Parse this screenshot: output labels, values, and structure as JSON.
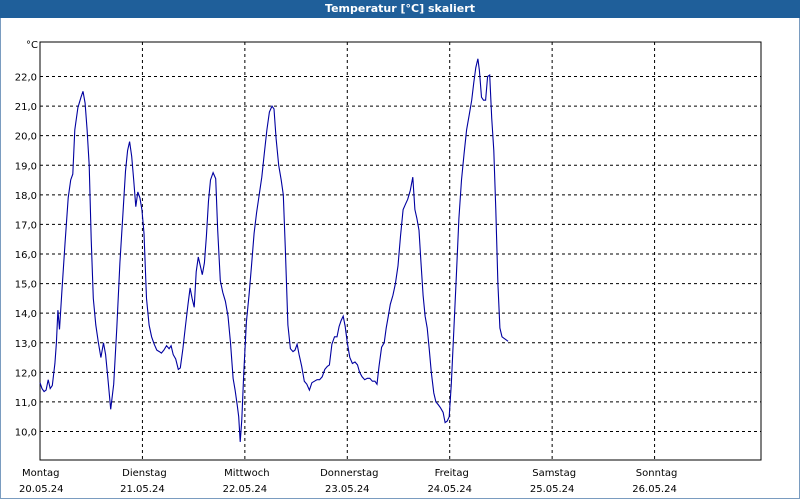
{
  "window": {
    "title": "Temperatur [°C] skaliert"
  },
  "chart_data": {
    "type": "line",
    "title": "Temperatur [°C] skaliert",
    "yunit": "°C",
    "ylim": [
      9.0,
      23.3
    ],
    "yticks": [
      10.0,
      11.0,
      12.0,
      13.0,
      14.0,
      15.0,
      16.0,
      17.0,
      18.0,
      19.0,
      20.0,
      21.0,
      22.0
    ],
    "ytick_labels": [
      "10,0",
      "11,0",
      "12,0",
      "13,0",
      "14,0",
      "15,0",
      "16,0",
      "17,0",
      "18,0",
      "19,0",
      "20,0",
      "21,0",
      "22,0"
    ],
    "xlim_days": [
      0,
      7
    ],
    "xticks": [
      {
        "day": "Montag",
        "date": "20.05.24",
        "pos": 0
      },
      {
        "day": "Dienstag",
        "date": "21.05.24",
        "pos": 1
      },
      {
        "day": "Mittwoch",
        "date": "22.05.24",
        "pos": 2
      },
      {
        "day": "Donnerstag",
        "date": "23.05.24",
        "pos": 3
      },
      {
        "day": "Freitag",
        "date": "24.05.24",
        "pos": 4
      },
      {
        "day": "Samstag",
        "date": "25.05.24",
        "pos": 5
      },
      {
        "day": "Sonntag",
        "date": "26.05.24",
        "pos": 6
      }
    ],
    "grid": true,
    "series": [
      {
        "color": "#0000a0",
        "points": [
          [
            0.0,
            11.65
          ],
          [
            0.02,
            11.45
          ],
          [
            0.04,
            11.35
          ],
          [
            0.06,
            11.4
          ],
          [
            0.08,
            11.75
          ],
          [
            0.1,
            11.45
          ],
          [
            0.12,
            11.55
          ],
          [
            0.145,
            12.3
          ],
          [
            0.16,
            13.0
          ],
          [
            0.175,
            14.1
          ],
          [
            0.19,
            13.45
          ],
          [
            0.215,
            14.8
          ],
          [
            0.245,
            16.4
          ],
          [
            0.275,
            17.9
          ],
          [
            0.3,
            18.5
          ],
          [
            0.32,
            18.7
          ],
          [
            0.34,
            20.2
          ],
          [
            0.37,
            20.95
          ],
          [
            0.4,
            21.3
          ],
          [
            0.42,
            21.5
          ],
          [
            0.44,
            21.1
          ],
          [
            0.46,
            20.2
          ],
          [
            0.48,
            19.0
          ],
          [
            0.5,
            16.5
          ],
          [
            0.52,
            14.5
          ],
          [
            0.545,
            13.6
          ],
          [
            0.57,
            13.0
          ],
          [
            0.595,
            12.5
          ],
          [
            0.62,
            13.0
          ],
          [
            0.64,
            12.6
          ],
          [
            0.66,
            11.9
          ],
          [
            0.69,
            10.75
          ],
          [
            0.72,
            11.6
          ],
          [
            0.75,
            13.5
          ],
          [
            0.78,
            15.7
          ],
          [
            0.81,
            17.4
          ],
          [
            0.835,
            18.8
          ],
          [
            0.855,
            19.5
          ],
          [
            0.875,
            19.8
          ],
          [
            0.895,
            19.3
          ],
          [
            0.915,
            18.5
          ],
          [
            0.935,
            17.6
          ],
          [
            0.955,
            18.1
          ],
          [
            0.975,
            17.9
          ],
          [
            0.995,
            17.5
          ],
          [
            1.015,
            16.7
          ],
          [
            1.04,
            14.5
          ],
          [
            1.065,
            13.6
          ],
          [
            1.09,
            13.2
          ],
          [
            1.115,
            12.95
          ],
          [
            1.14,
            12.75
          ],
          [
            1.165,
            12.7
          ],
          [
            1.185,
            12.65
          ],
          [
            1.21,
            12.75
          ],
          [
            1.235,
            12.9
          ],
          [
            1.26,
            12.8
          ],
          [
            1.28,
            12.9
          ],
          [
            1.3,
            12.6
          ],
          [
            1.325,
            12.45
          ],
          [
            1.35,
            12.1
          ],
          [
            1.37,
            12.15
          ],
          [
            1.395,
            12.8
          ],
          [
            1.42,
            13.55
          ],
          [
            1.445,
            14.3
          ],
          [
            1.465,
            14.85
          ],
          [
            1.485,
            14.5
          ],
          [
            1.505,
            14.2
          ],
          [
            1.525,
            15.4
          ],
          [
            1.545,
            15.9
          ],
          [
            1.565,
            15.6
          ],
          [
            1.585,
            15.3
          ],
          [
            1.605,
            15.7
          ],
          [
            1.625,
            16.6
          ],
          [
            1.645,
            17.8
          ],
          [
            1.665,
            18.5
          ],
          [
            1.69,
            18.75
          ],
          [
            1.715,
            18.55
          ],
          [
            1.735,
            16.8
          ],
          [
            1.76,
            15.1
          ],
          [
            1.785,
            14.7
          ],
          [
            1.81,
            14.4
          ],
          [
            1.835,
            13.9
          ],
          [
            1.86,
            13.0
          ],
          [
            1.885,
            11.8
          ],
          [
            1.905,
            11.4
          ],
          [
            1.925,
            10.9
          ],
          [
            1.94,
            10.5
          ],
          [
            1.955,
            9.65
          ],
          [
            1.97,
            10.4
          ],
          [
            1.99,
            12.0
          ],
          [
            2.015,
            13.7
          ],
          [
            2.04,
            14.6
          ],
          [
            2.065,
            15.6
          ],
          [
            2.09,
            16.7
          ],
          [
            2.115,
            17.4
          ],
          [
            2.14,
            18.0
          ],
          [
            2.165,
            18.6
          ],
          [
            2.19,
            19.4
          ],
          [
            2.215,
            20.2
          ],
          [
            2.24,
            20.8
          ],
          [
            2.265,
            21.0
          ],
          [
            2.285,
            20.9
          ],
          [
            2.305,
            19.9
          ],
          [
            2.33,
            19.0
          ],
          [
            2.355,
            18.5
          ],
          [
            2.375,
            18.0
          ],
          [
            2.395,
            16.2
          ],
          [
            2.42,
            13.6
          ],
          [
            2.445,
            12.8
          ],
          [
            2.47,
            12.7
          ],
          [
            2.49,
            12.75
          ],
          [
            2.51,
            12.95
          ],
          [
            2.53,
            12.6
          ],
          [
            2.555,
            12.2
          ],
          [
            2.58,
            11.7
          ],
          [
            2.605,
            11.6
          ],
          [
            2.63,
            11.4
          ],
          [
            2.655,
            11.65
          ],
          [
            2.68,
            11.7
          ],
          [
            2.705,
            11.75
          ],
          [
            2.73,
            11.75
          ],
          [
            2.755,
            11.85
          ],
          [
            2.78,
            12.1
          ],
          [
            2.805,
            12.2
          ],
          [
            2.825,
            12.25
          ],
          [
            2.85,
            12.95
          ],
          [
            2.875,
            13.2
          ],
          [
            2.9,
            13.2
          ],
          [
            2.92,
            13.55
          ],
          [
            2.94,
            13.75
          ],
          [
            2.96,
            13.9
          ],
          [
            2.98,
            13.55
          ],
          [
            3.0,
            13.0
          ],
          [
            3.025,
            12.5
          ],
          [
            3.05,
            12.3
          ],
          [
            3.075,
            12.35
          ],
          [
            3.1,
            12.25
          ],
          [
            3.12,
            12.0
          ],
          [
            3.145,
            11.85
          ],
          [
            3.17,
            11.75
          ],
          [
            3.195,
            11.8
          ],
          [
            3.22,
            11.8
          ],
          [
            3.245,
            11.7
          ],
          [
            3.27,
            11.7
          ],
          [
            3.29,
            11.6
          ],
          [
            3.31,
            12.2
          ],
          [
            3.335,
            12.85
          ],
          [
            3.36,
            13.0
          ],
          [
            3.38,
            13.5
          ],
          [
            3.4,
            13.9
          ],
          [
            3.42,
            14.3
          ],
          [
            3.445,
            14.6
          ],
          [
            3.47,
            15.0
          ],
          [
            3.495,
            15.6
          ],
          [
            3.52,
            16.6
          ],
          [
            3.545,
            17.5
          ],
          [
            3.57,
            17.7
          ],
          [
            3.59,
            17.85
          ],
          [
            3.615,
            18.15
          ],
          [
            3.64,
            18.6
          ],
          [
            3.66,
            17.5
          ],
          [
            3.68,
            17.2
          ],
          [
            3.7,
            16.8
          ],
          [
            3.72,
            15.7
          ],
          [
            3.74,
            14.6
          ],
          [
            3.76,
            13.9
          ],
          [
            3.78,
            13.5
          ],
          [
            3.8,
            12.8
          ],
          [
            3.82,
            12.0
          ],
          [
            3.845,
            11.3
          ],
          [
            3.865,
            11.0
          ],
          [
            3.89,
            10.9
          ],
          [
            3.91,
            10.8
          ],
          [
            3.935,
            10.65
          ],
          [
            3.955,
            10.3
          ],
          [
            3.975,
            10.35
          ],
          [
            3.995,
            10.5
          ],
          [
            4.015,
            11.6
          ],
          [
            4.04,
            13.4
          ],
          [
            4.065,
            15.3
          ],
          [
            4.09,
            17.2
          ],
          [
            4.115,
            18.5
          ],
          [
            4.14,
            19.4
          ],
          [
            4.165,
            20.2
          ],
          [
            4.19,
            20.7
          ],
          [
            4.215,
            21.2
          ],
          [
            4.235,
            21.8
          ],
          [
            4.255,
            22.3
          ],
          [
            4.275,
            22.6
          ],
          [
            4.29,
            22.2
          ],
          [
            4.31,
            21.3
          ],
          [
            4.33,
            21.2
          ],
          [
            4.35,
            21.2
          ],
          [
            4.37,
            22.0
          ],
          [
            4.39,
            22.05
          ],
          [
            4.41,
            20.6
          ],
          [
            4.43,
            19.5
          ],
          [
            4.45,
            17.5
          ],
          [
            4.47,
            15.0
          ],
          [
            4.49,
            13.5
          ],
          [
            4.51,
            13.2
          ],
          [
            4.53,
            13.15
          ],
          [
            4.55,
            13.1
          ],
          [
            4.57,
            13.05
          ]
        ]
      }
    ]
  }
}
